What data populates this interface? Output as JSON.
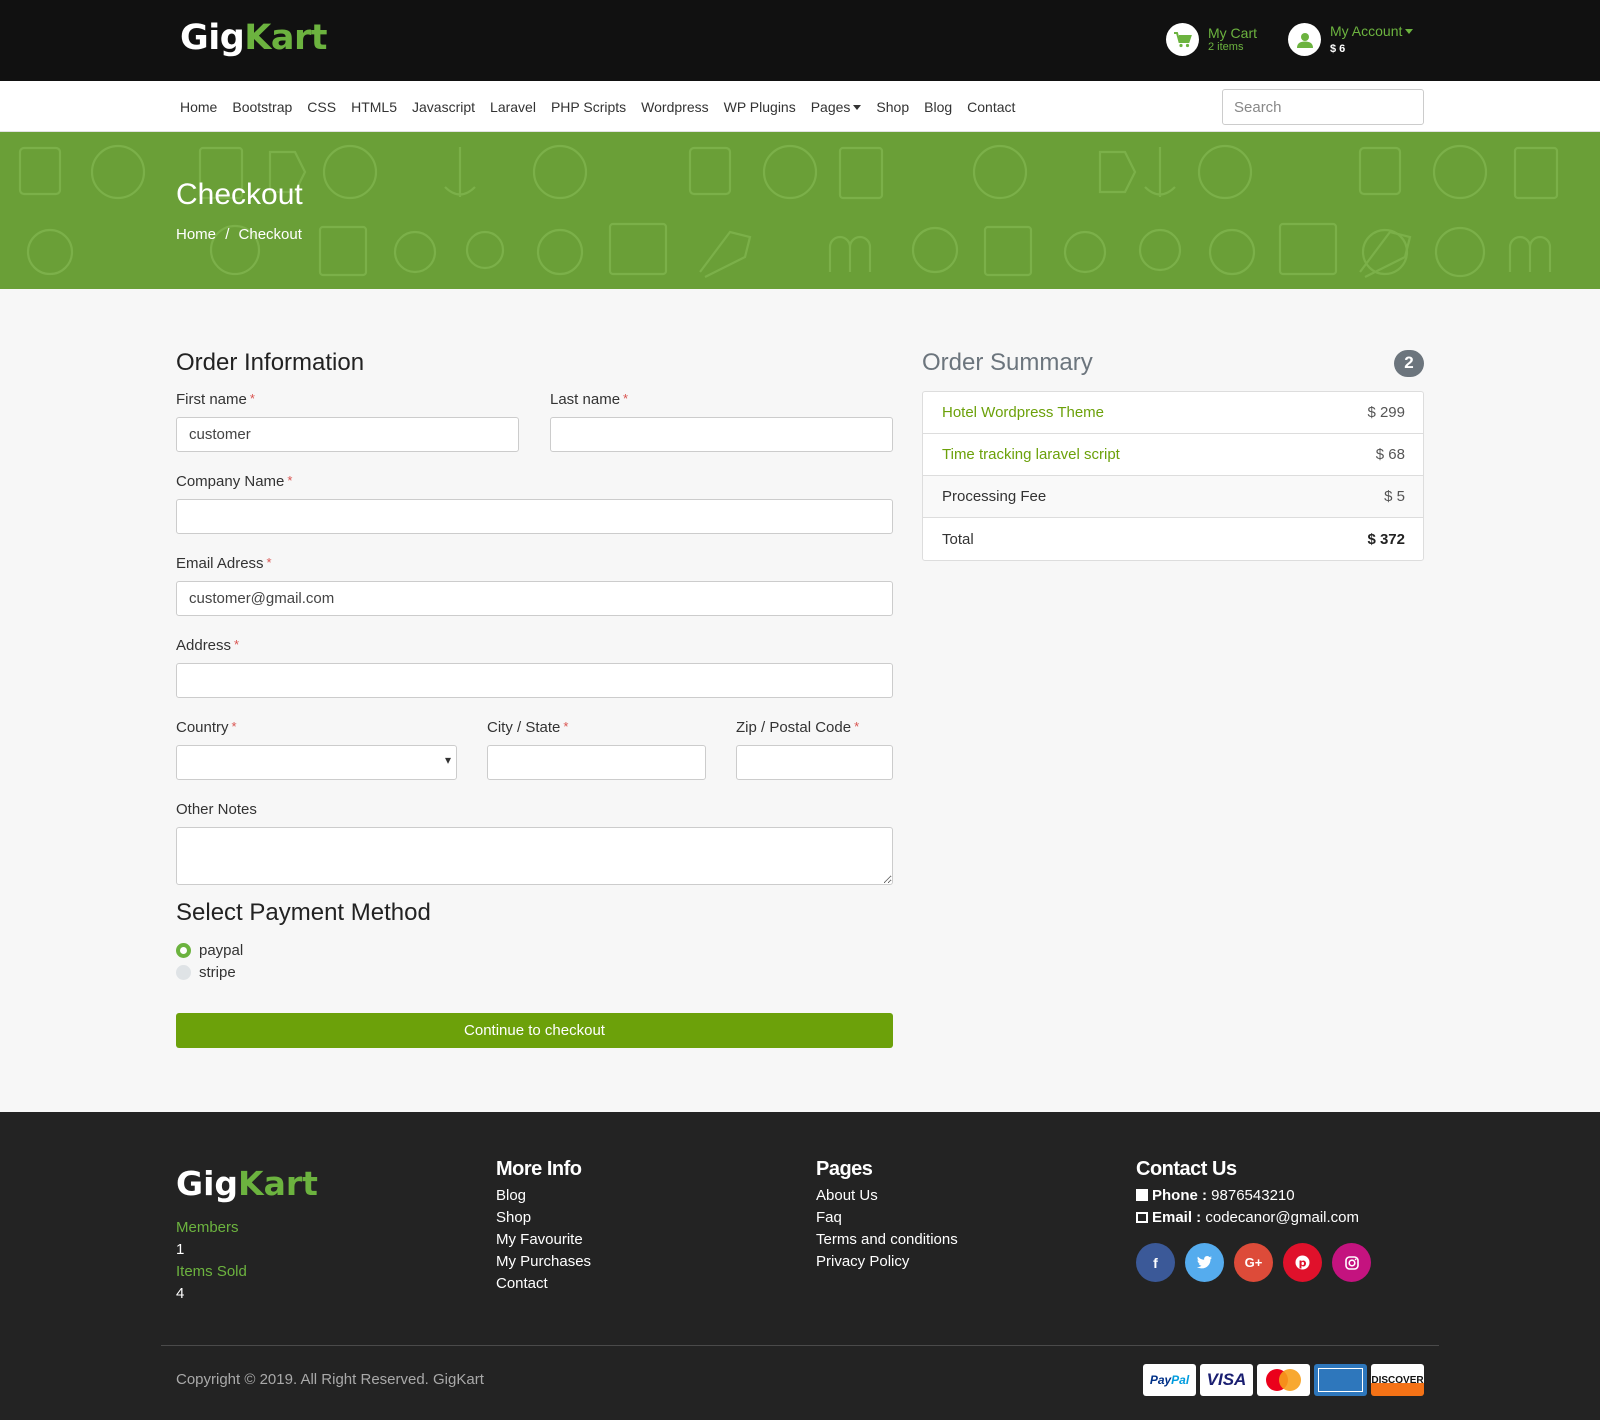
{
  "brand": {
    "part1": "Gig",
    "part2": "Kart"
  },
  "header": {
    "cart_title": "My Cart",
    "cart_count": "2 items",
    "account_title": "My Account",
    "account_balance": "$ 6"
  },
  "nav": {
    "items": [
      "Home",
      "Bootstrap",
      "CSS",
      "HTML5",
      "Javascript",
      "Laravel",
      "PHP Scripts",
      "Wordpress",
      "WP Plugins",
      "Pages",
      "Shop",
      "Blog",
      "Contact"
    ],
    "search_placeholder": "Search"
  },
  "banner": {
    "title": "Checkout",
    "breadcrumb_home": "Home",
    "breadcrumb_sep": "/",
    "breadcrumb_current": "Checkout"
  },
  "order_info": {
    "title": "Order Information",
    "first_name_label": "First name",
    "first_name_value": "customer",
    "last_name_label": "Last name",
    "last_name_value": "",
    "company_label": "Company Name",
    "company_value": "",
    "email_label": "Email Adress",
    "email_value": "customer@gmail.com",
    "address_label": "Address",
    "address_value": "",
    "country_label": "Country",
    "country_value": "",
    "city_label": "City / State",
    "city_value": "",
    "zip_label": "Zip / Postal Code",
    "zip_value": "",
    "notes_label": "Other Notes",
    "notes_value": "",
    "required_mark": "*"
  },
  "payment": {
    "title": "Select Payment Method",
    "options": [
      "paypal",
      "stripe"
    ],
    "selected": "paypal",
    "submit_label": "Continue to checkout"
  },
  "summary": {
    "title": "Order Summary",
    "count": "2",
    "items": [
      {
        "name": "Hotel Wordpress Theme",
        "price": "$ 299"
      },
      {
        "name": "Time tracking laravel script",
        "price": "$ 68"
      }
    ],
    "fee_label": "Processing Fee",
    "fee_value": "$ 5",
    "total_label": "Total",
    "total_value": "$ 372"
  },
  "footer": {
    "members_label": "Members",
    "members_value": "1",
    "items_sold_label": "Items Sold",
    "items_sold_value": "4",
    "more_info_title": "More Info",
    "more_info_links": [
      "Blog",
      "Shop",
      "My Favourite",
      "My Purchases",
      "Contact"
    ],
    "pages_title": "Pages",
    "pages_links": [
      "About Us",
      "Faq",
      "Terms and conditions",
      "Privacy Policy"
    ],
    "contact_title": "Contact Us",
    "phone_label": "Phone :",
    "phone_value": "9876543210",
    "email_label": "Email :",
    "email_value": "codecanor@gmail.com",
    "social_icons": [
      "facebook-icon",
      "twitter-icon",
      "google-plus-icon",
      "pinterest-icon",
      "instagram-icon"
    ],
    "copyright": "Copyright © 2019. All Right Reserved. GigKart",
    "payment_icons": [
      "paypal",
      "visa",
      "mastercard",
      "american-express",
      "discover"
    ]
  },
  "colors": {
    "accent": "#6cb33f",
    "button": "#6ca10a",
    "banner": "#6a9f37",
    "header_bg": "#111111",
    "footer_bg": "#232323"
  }
}
